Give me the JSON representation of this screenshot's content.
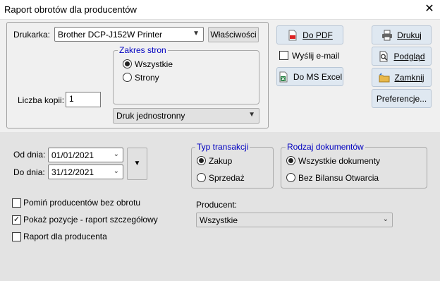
{
  "window": {
    "title": "Raport obrotów dla producentów",
    "close_glyph": "✕"
  },
  "printer": {
    "label": "Drukarka:",
    "value": "Brother DCP-J152W Printer",
    "properties_button": "Właściwości"
  },
  "page_range": {
    "legend": "Zakres stron",
    "all": "Wszystkie",
    "pages": "Strony",
    "selected": "all"
  },
  "copies": {
    "label": "Liczba kopii:",
    "value": "1"
  },
  "duplex": {
    "value": "Druk jednostronny"
  },
  "export": {
    "pdf_label": "Do PDF",
    "email_label": "Wyślij e-mail",
    "email_checked": false,
    "excel_label": "Do MS Excel"
  },
  "actions": {
    "print": "Drukuj",
    "preview": "Podgląd",
    "close": "Zamknij",
    "preferences": "Preferencje..."
  },
  "dates": {
    "from_label": "Od dnia:",
    "from_value": "01/01/2021",
    "to_label": "Do dnia:",
    "to_value": "31/12/2021"
  },
  "options": {
    "skip_no_turnover": {
      "label": "Pomiń producentów bez obrotu",
      "checked": false
    },
    "show_items": {
      "label": "Pokaż pozycje - raport szczegółowy",
      "checked": true
    },
    "per_producer": {
      "label": "Raport dla producenta",
      "checked": false
    }
  },
  "transaction_type": {
    "legend": "Typ transakcji",
    "purchase": "Zakup",
    "sale": "Sprzedaż",
    "selected": "purchase"
  },
  "document_type": {
    "legend": "Rodzaj dokumentów",
    "all": "Wszystkie dokumenty",
    "no_opening": "Bez Bilansu Otwarcia",
    "selected": "all"
  },
  "producer": {
    "label": "Producent:",
    "value": "Wszystkie"
  },
  "icons": {
    "pdf": "pdf-file-icon",
    "excel": "excel-file-icon",
    "print": "printer-icon",
    "preview": "preview-icon",
    "close": "close-folder-icon"
  }
}
